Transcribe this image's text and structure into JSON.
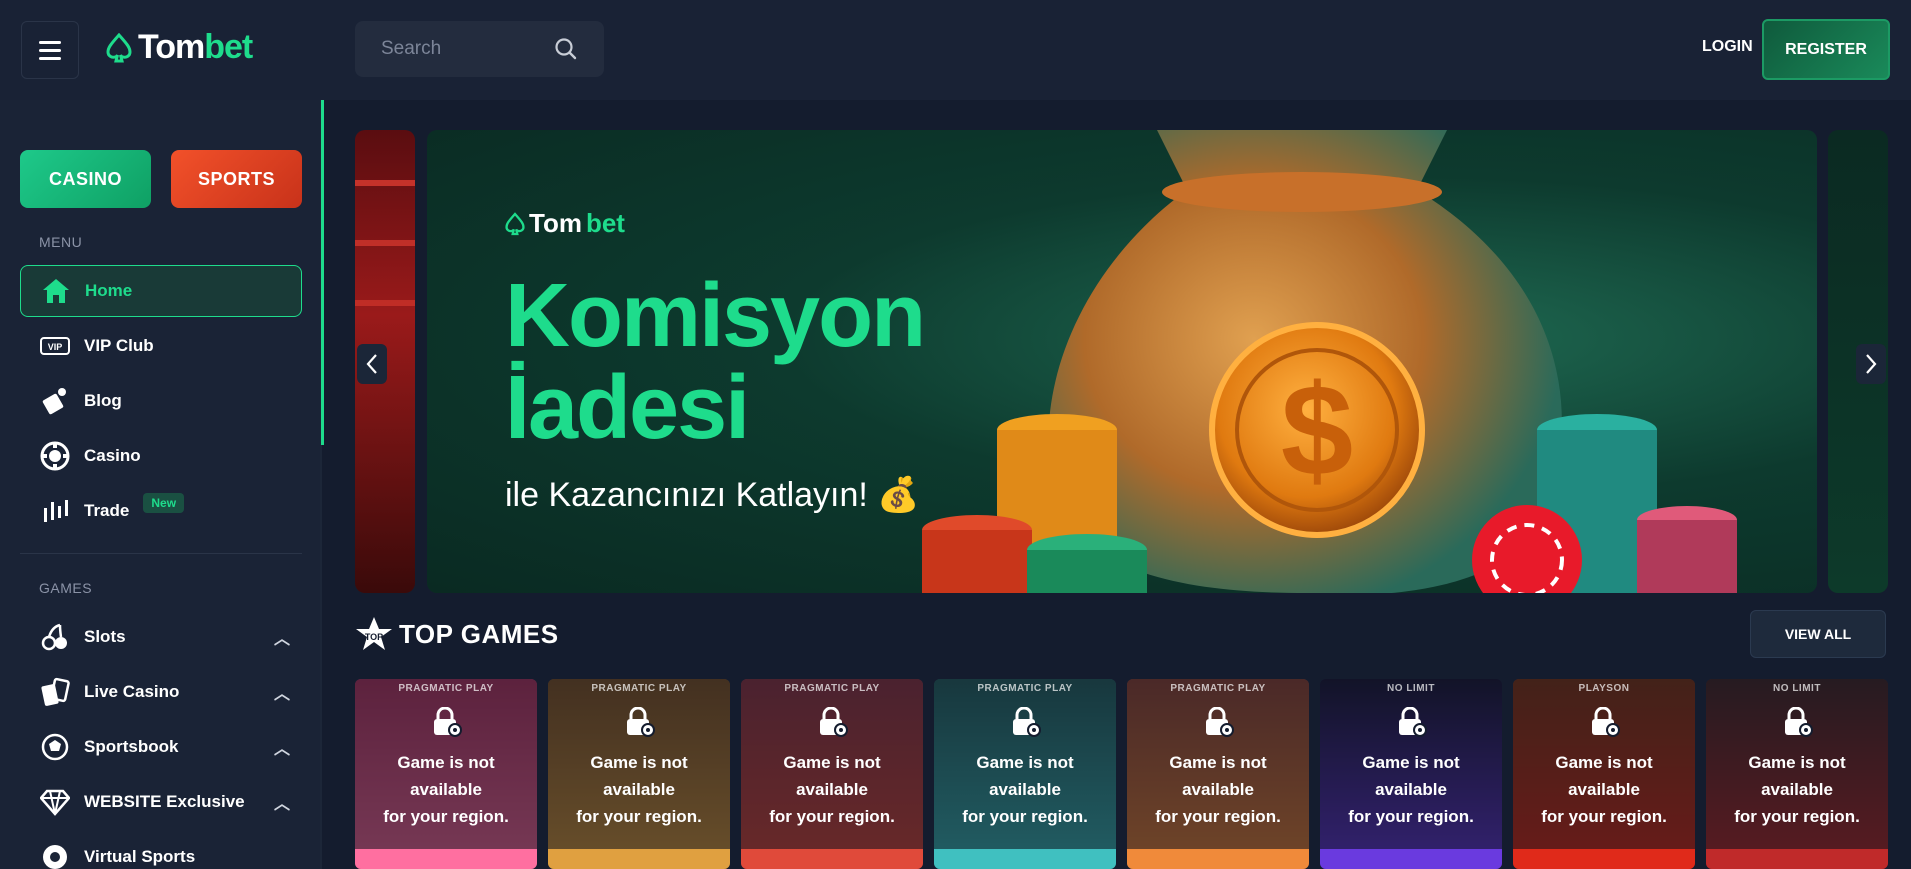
{
  "header": {
    "logo_part1": "Tom",
    "logo_part2": "bet",
    "search_placeholder": "Search",
    "login_label": "LOGIN",
    "register_label": "REGISTER"
  },
  "sidebar": {
    "tabs": [
      {
        "label": "CASINO"
      },
      {
        "label": "SPORTS"
      }
    ],
    "menu_label": "MENU",
    "menu_items": [
      {
        "label": "Home",
        "icon": "home-icon"
      },
      {
        "label": "VIP Club",
        "icon": "vip-icon"
      },
      {
        "label": "Blog",
        "icon": "blog-icon"
      },
      {
        "label": "Casino",
        "icon": "casino-chip-icon"
      },
      {
        "label": "Trade",
        "icon": "trade-chart-icon",
        "badge": "New"
      }
    ],
    "games_label": "GAMES",
    "game_items": [
      {
        "label": "Slots",
        "icon": "cherries-icon"
      },
      {
        "label": "Live Casino",
        "icon": "cards-icon"
      },
      {
        "label": "Sportsbook",
        "icon": "sportsbook-icon"
      },
      {
        "label": "WEBSITE Exclusive",
        "icon": "diamond-icon"
      },
      {
        "label": "Virtual Sports",
        "icon": "virtual-sports-icon"
      }
    ]
  },
  "banner": {
    "logo_part1": "Tom",
    "logo_part2": "bet",
    "title_line1": "Komisyon",
    "title_line2": "İadesi",
    "subtitle": "ile Kazancınızı Katlayın! 💰"
  },
  "top_games": {
    "title": "TOP GAMES",
    "view_all_label": "VIEW ALL",
    "unavailable_line1": "Game is not available",
    "unavailable_line2": "for your region.",
    "games": [
      {
        "provider": "PRAGMATIC PLAY",
        "bg": "#c23a6a",
        "accent": "#ff6fa0"
      },
      {
        "provider": "PRAGMATIC PLAY",
        "bg": "#8a5a2a",
        "accent": "#e0a040"
      },
      {
        "provider": "PRAGMATIC PLAY",
        "bg": "#9a3a4a",
        "accent": "#e04a3a"
      },
      {
        "provider": "PRAGMATIC PLAY",
        "bg": "#2a6a6a",
        "accent": "#40c0c0"
      },
      {
        "provider": "PRAGMATIC PLAY",
        "bg": "#9a4a3a",
        "accent": "#f08a3a"
      },
      {
        "provider": "NO LIMIT",
        "bg": "#1e1a3a",
        "accent": "#6a3adf"
      },
      {
        "provider": "PLAYSON",
        "bg": "#8a3a1a",
        "accent": "#e02a1a"
      },
      {
        "provider": "NO LIMIT",
        "bg": "#4a2a2a",
        "accent": "#c02a2a"
      }
    ]
  }
}
